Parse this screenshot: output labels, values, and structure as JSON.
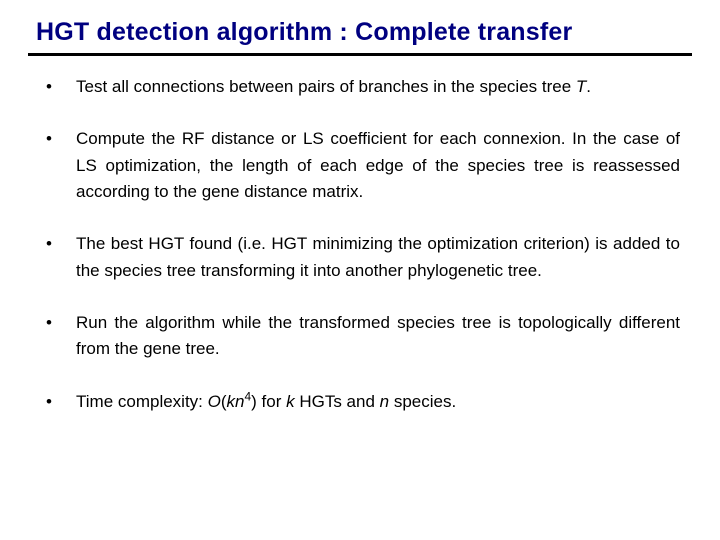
{
  "title": "HGT detection algorithm : Complete transfer",
  "bullets": [
    {
      "pre": "Test all connections between pairs of branches in the species tree ",
      "var": "T",
      "post": "."
    },
    {
      "pre": "Compute the RF distance or LS coefficient for each connexion. In the case of LS optimization, the length of each edge of the species tree is reassessed according to the gene distance matrix.",
      "var": "",
      "post": ""
    },
    {
      "pre": "The best HGT found (i.e. HGT minimizing the optimization criterion) is added to the species tree transforming it into another phylogenetic tree.",
      "var": "",
      "post": ""
    },
    {
      "pre": "Run the algorithm while the transformed species tree is topologically different from the gene tree.",
      "var": "",
      "post": ""
    }
  ],
  "complexity": {
    "pre": "Time complexity: ",
    "bigO": "O",
    "open": "(",
    "k": "k",
    "n": "n",
    "exp": "4",
    "close": ")",
    "mid": " for ",
    "k2": "k",
    "mid2": " HGTs and ",
    "n2": "n",
    "post": " species."
  }
}
